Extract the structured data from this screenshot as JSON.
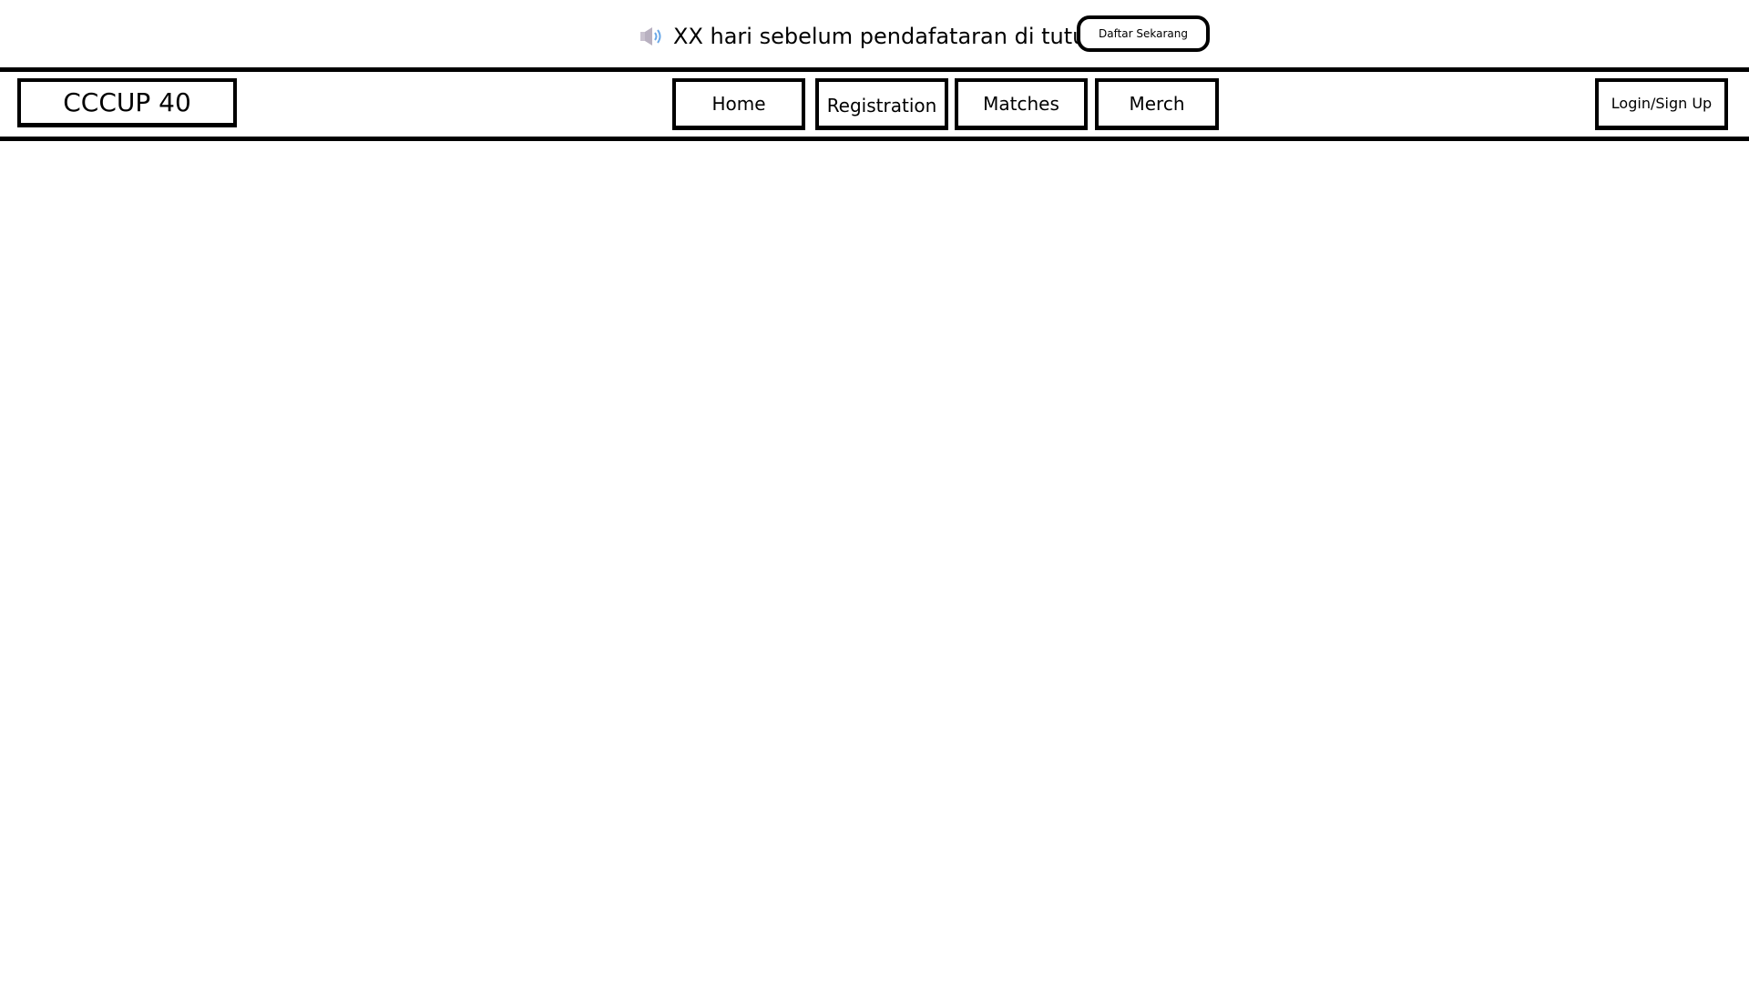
{
  "announcement": {
    "icon": "speaker-icon",
    "text": "XX hari sebelum pendafataran di tutup",
    "cta_label": "Daftar Sekarang"
  },
  "header": {
    "logo": "CCCUP 40",
    "nav": {
      "home": "Home",
      "registration": "Registration",
      "matches": "Matches",
      "merch": "Merch"
    },
    "login_label": "Login/Sign Up"
  },
  "colors": {
    "border": "#000000",
    "background": "#ffffff",
    "icon_body": "#c9c2cf",
    "icon_waves": "#6aa8e8"
  }
}
